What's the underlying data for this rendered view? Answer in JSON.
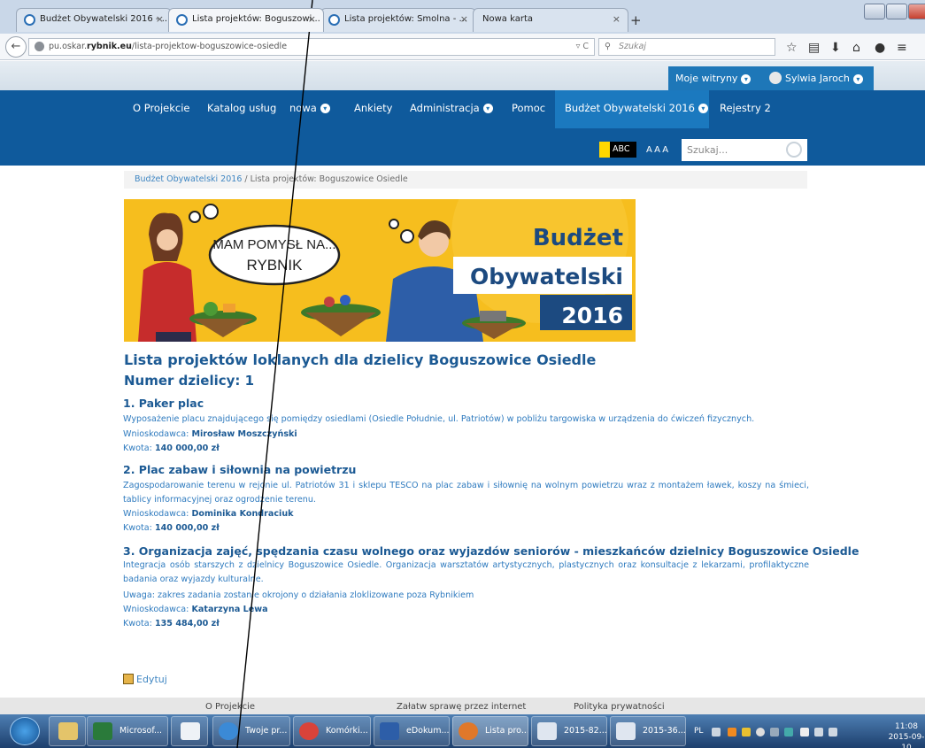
{
  "browser": {
    "tabs": [
      {
        "label": "Budżet Obywatelski 2016 - ..."
      },
      {
        "label": "Lista projektów: Boguszowi..."
      },
      {
        "label": "Lista projektów: Smolna - ..."
      },
      {
        "label": "Nowa karta"
      }
    ],
    "url": {
      "domain_pre": "pu.oskar.",
      "domain_bold": "rybnik.eu",
      "path": "/lista-projektow-boguszowice-osiedle"
    },
    "search_placeholder": "Szukaj"
  },
  "site": {
    "userbar": {
      "my_sites": "Moje witryny",
      "user": "Sylwia Jaroch"
    },
    "nav": [
      {
        "label": "O Projekcie"
      },
      {
        "label": "Katalog usług"
      },
      {
        "label": "nowa"
      },
      {
        "label": "Ankiety"
      },
      {
        "label": "Administracja"
      },
      {
        "label": "Pomoc"
      },
      {
        "label": "Budżet Obywatelski 2016"
      },
      {
        "label": "Rejestry 2"
      }
    ],
    "contrast_label": "ABC",
    "fontsize_label": "AAA",
    "search_placeholder": "Szukaj..."
  },
  "breadcrumb": {
    "link": "Budżet Obywatelski 2016",
    "sep": "/",
    "current": "Lista projektów: Boguszowice Osiedle"
  },
  "banner": {
    "bubble_line1": "MAM POMYSŁ NA...",
    "bubble_line2": "RYBNIK",
    "word1": "Budżet",
    "word2": "Obywatelski",
    "year": "2016"
  },
  "content": {
    "title": "Lista projektów loklanych dla dzielicy Boguszowice Osiedle",
    "subtitle": "Numer dzielicy: 1",
    "applicant_label": "Wnioskodawca:",
    "amount_label": "Kwota:",
    "projects": [
      {
        "heading": "1. Paker plac",
        "desc": "Wyposażenie placu znajdującego się pomiędzy osiedlami (Osiedle Południe, ul. Patriotów) w pobliżu targowiska w urządzenia do ćwiczeń fizycznych.",
        "applicant": "Mirosław Moszczyński",
        "amount": "140 000,00 zł"
      },
      {
        "heading": "2. Plac zabaw i siłownia na powietrzu",
        "desc": "Zagospodarowanie terenu w rejonie ul. Patriotów 31 i sklepu TESCO na plac zabaw i siłownię na wolnym powietrzu wraz z montażem ławek, koszy na śmieci, tablicy informacyjnej oraz ogrodzenie terenu.",
        "applicant": "Dominika Kondraciuk",
        "amount": "140 000,00 zł"
      },
      {
        "heading": "3. Organizacja zajęć, spędzania czasu wolnego oraz wyjazdów seniorów - mieszkańców dzielnicy Boguszowice Osiedle",
        "desc": "Integracja osób starszych z dzielnicy Boguszowice Osiedle. Organizacja warsztatów artystycznych, plastycznych oraz konsultacje z lekarzami, profilaktyczne badania oraz wyjazdy kulturalne.",
        "note": "Uwaga: zakres zadania zostanie okrojony o działania zloklizowane poza Rybnikiem",
        "applicant": "Katarzyna Lewa",
        "amount": "135 484,00 zł"
      }
    ],
    "edit_label": "Edytuj"
  },
  "footer": {
    "links": [
      "O Projekcie",
      "Załatw sprawę przez internet",
      "Polityka prywatności"
    ]
  },
  "taskbar": {
    "items": [
      {
        "label": "Microsof..."
      },
      {
        "label": "Twoje pr..."
      },
      {
        "label": "Komórki..."
      },
      {
        "label": "eDokum..."
      },
      {
        "label": "Lista pro..."
      },
      {
        "label": "2015-82..."
      },
      {
        "label": "2015-36..."
      }
    ],
    "lang": "PL",
    "time": "11:08",
    "date": "2015-09-10"
  },
  "colors": {
    "nav": "#0f5a9c",
    "nav_active": "#1b79bf",
    "heading": "#1c5a94",
    "text": "#2f7bbf",
    "banner": "#f6be1e"
  }
}
